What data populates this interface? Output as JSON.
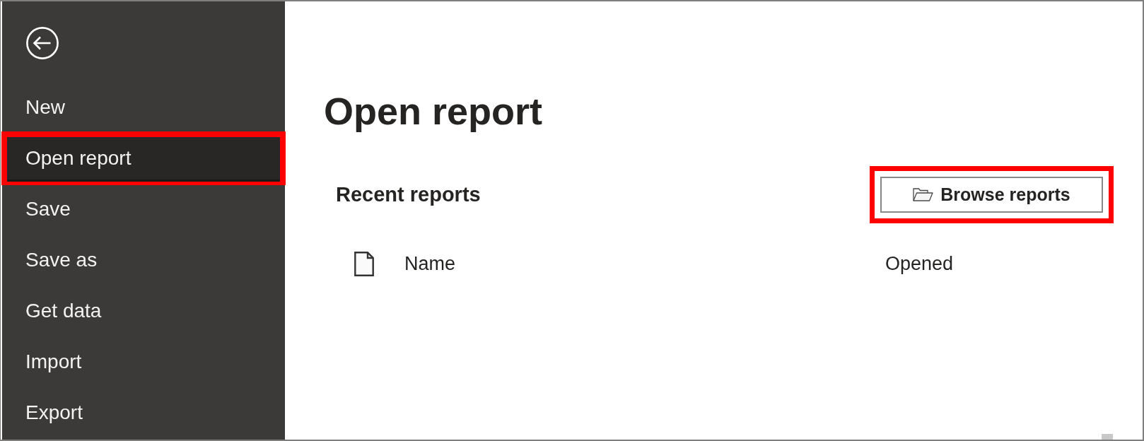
{
  "menu": [
    {
      "label": "New",
      "selected": false,
      "highlighted": false
    },
    {
      "label": "Open report",
      "selected": true,
      "highlighted": true
    },
    {
      "label": "Save",
      "selected": false,
      "highlighted": false
    },
    {
      "label": "Save as",
      "selected": false,
      "highlighted": false
    },
    {
      "label": "Get data",
      "selected": false,
      "highlighted": false
    },
    {
      "label": "Import",
      "selected": false,
      "highlighted": false
    },
    {
      "label": "Export",
      "selected": false,
      "highlighted": false
    }
  ],
  "page": {
    "title": "Open report"
  },
  "recent": {
    "heading": "Recent reports",
    "browse_button": {
      "label": "Browse reports",
      "highlighted": true
    },
    "columns": [
      {
        "label": "Name"
      },
      {
        "label": "Opened"
      }
    ]
  }
}
